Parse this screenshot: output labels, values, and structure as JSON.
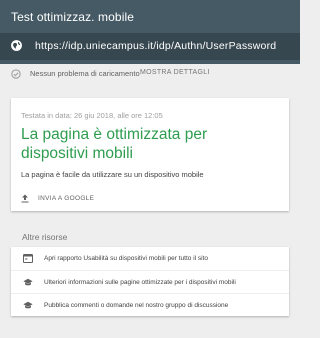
{
  "header": {
    "title": "Test ottimizzaz. mobile",
    "url": "https://idp.uniecampus.it/idp/Authn/UserPassword"
  },
  "status": {
    "message": "Nessun problema di caricamento",
    "details_link": "MOSTRA DETTAGLI"
  },
  "result": {
    "tested_on": "Testata in data: 26 giu 2018, alle ore 12:05",
    "headline": "La pagina è ottimizzata per dispositivi mobili",
    "subtitle": "La pagina è facile da utilizzare su un dispositivo mobile",
    "share_label": "INVIA A GOOGLE"
  },
  "resources": {
    "title": "Altre risorse",
    "items": [
      {
        "label": "Apri rapporto Usabilità su dispositivi mobili per tutto il sito",
        "icon": "report-icon"
      },
      {
        "label": "Ulteriori informazioni sulle pagine ottimizzate per i dispositivi mobili",
        "icon": "school-icon"
      },
      {
        "label": "Pubblica commenti o domande nel nostro gruppo di discussione",
        "icon": "school-icon"
      }
    ]
  },
  "colors": {
    "header": "#455a64",
    "urlbar": "#37474f",
    "success": "#2e9d4f",
    "background": "#eeeeee"
  }
}
